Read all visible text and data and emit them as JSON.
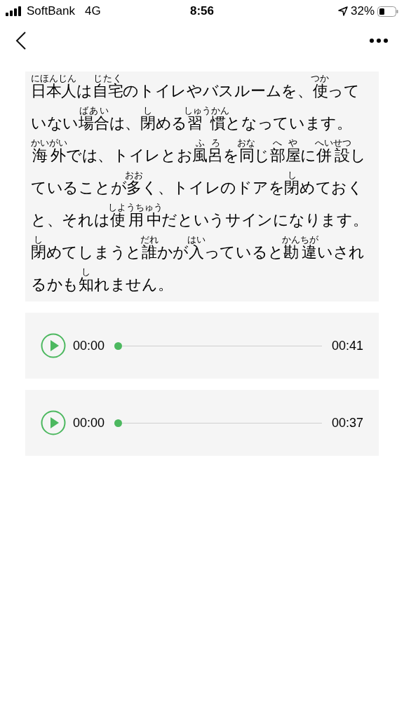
{
  "status_bar": {
    "carrier": "SoftBank",
    "network": "4G",
    "time": "8:56",
    "battery": "32%"
  },
  "passage_lines": [
    [
      {
        "text": "日本人",
        "ruby": "にほんじん"
      },
      {
        "text": "は"
      },
      {
        "text": "自宅",
        "ruby": "じたく"
      },
      {
        "text": "のトイレやバスルームを、"
      },
      {
        "text": "使",
        "ruby": "つか"
      },
      {
        "text": "って"
      }
    ],
    [
      {
        "text": "いない"
      },
      {
        "text": "場合",
        "ruby": "ばあい"
      },
      {
        "text": "は、"
      },
      {
        "text": "閉",
        "ruby": "し"
      },
      {
        "text": "める"
      },
      {
        "text": "習慣",
        "ruby": "しゅうかん"
      },
      {
        "text": "となっています。"
      }
    ],
    [
      {
        "text": "海外",
        "ruby": "かいがい"
      },
      {
        "text": "では、トイレとお"
      },
      {
        "text": "風呂",
        "ruby": "ふろ"
      },
      {
        "text": "を"
      },
      {
        "text": "同",
        "ruby": "おな"
      },
      {
        "text": "じ"
      },
      {
        "text": "部屋",
        "ruby": "へや"
      },
      {
        "text": "に"
      },
      {
        "text": "併設",
        "ruby": "へいせつ"
      },
      {
        "text": "し"
      }
    ],
    [
      {
        "text": "ていることが"
      },
      {
        "text": "多",
        "ruby": "おお"
      },
      {
        "text": "く、トイレのドアを"
      },
      {
        "text": "閉",
        "ruby": "し"
      },
      {
        "text": "めておく"
      }
    ],
    [
      {
        "text": "と、それは"
      },
      {
        "text": "使用中",
        "ruby": "しようちゅう"
      },
      {
        "text": "だというサインになります。"
      }
    ],
    [
      {
        "text": "閉",
        "ruby": "し"
      },
      {
        "text": "めてしまうと"
      },
      {
        "text": "誰",
        "ruby": "だれ"
      },
      {
        "text": "かが"
      },
      {
        "text": "入",
        "ruby": "はい"
      },
      {
        "text": "っていると"
      },
      {
        "text": "勘違",
        "ruby": "かんちが"
      },
      {
        "text": "いされ"
      }
    ],
    [
      {
        "text": "るかも"
      },
      {
        "text": "知",
        "ruby": "し"
      },
      {
        "text": "れません。"
      }
    ]
  ],
  "players": [
    {
      "current": "00:00",
      "duration": "00:41",
      "level": 0
    },
    {
      "current": "00:00",
      "duration": "00:37",
      "level": 0
    }
  ]
}
